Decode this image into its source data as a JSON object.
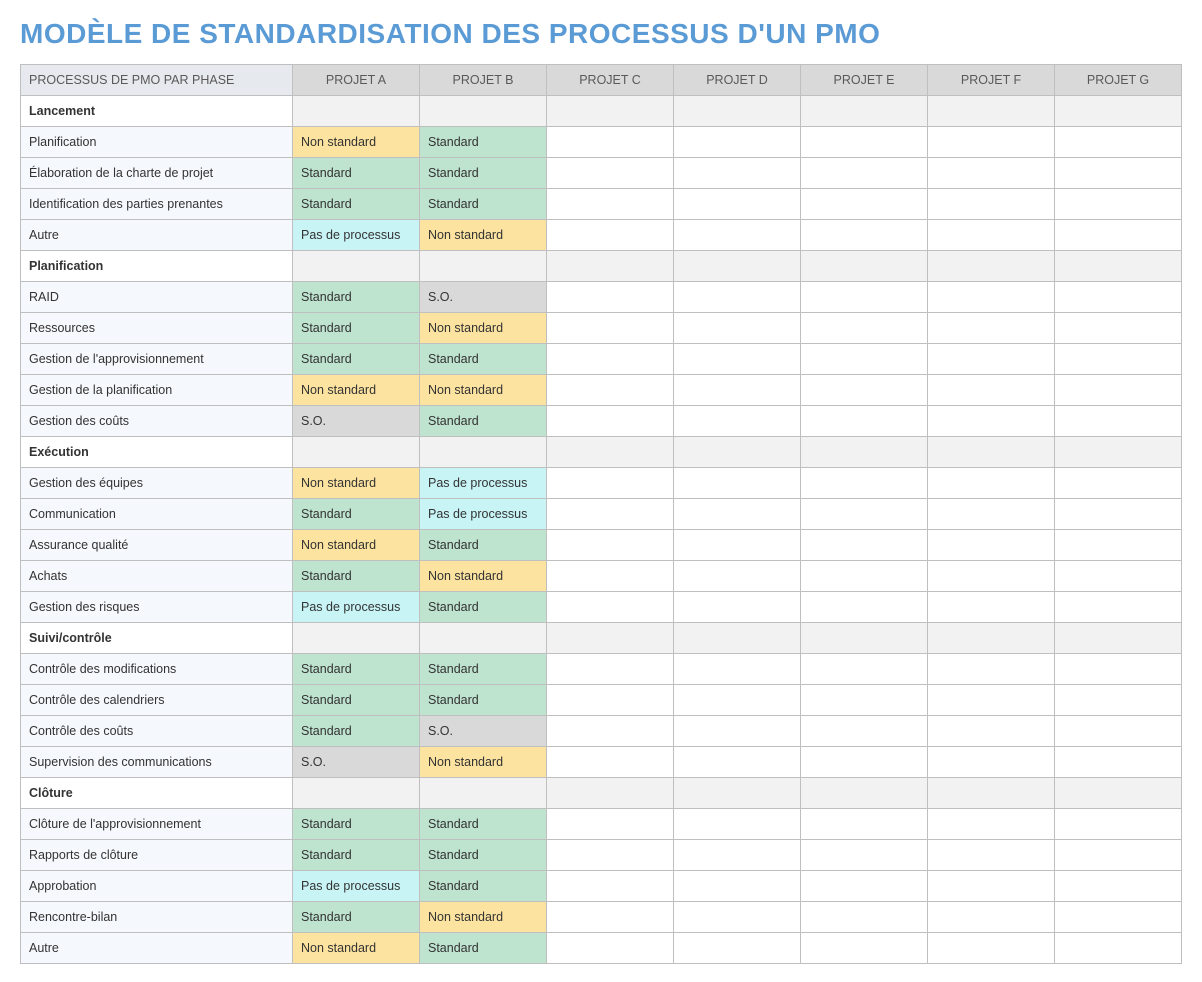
{
  "title": "MODÈLE DE STANDARDISATION DES PROCESSUS D'UN PMO",
  "headers": {
    "rowhead": "PROCESSUS DE PMO PAR PHASE",
    "projects": [
      "PROJET A",
      "PROJET B",
      "PROJET C",
      "PROJET D",
      "PROJET E",
      "PROJET F",
      "PROJET G"
    ]
  },
  "status_labels": {
    "standard": "Standard",
    "nonstd": "Non standard",
    "noproc": "Pas de processus",
    "so": "S.O."
  },
  "phases": [
    {
      "name": "Lancement",
      "rows": [
        {
          "label": "Planification",
          "cells": [
            "nonstd",
            "standard",
            "",
            "",
            "",
            "",
            ""
          ]
        },
        {
          "label": "Élaboration de la charte de projet",
          "cells": [
            "standard",
            "standard",
            "",
            "",
            "",
            "",
            ""
          ]
        },
        {
          "label": "Identification des parties prenantes",
          "cells": [
            "standard",
            "standard",
            "",
            "",
            "",
            "",
            ""
          ]
        },
        {
          "label": "Autre",
          "cells": [
            "noproc",
            "nonstd",
            "",
            "",
            "",
            "",
            ""
          ]
        }
      ]
    },
    {
      "name": "Planification",
      "rows": [
        {
          "label": "RAID",
          "cells": [
            "standard",
            "so",
            "",
            "",
            "",
            "",
            ""
          ]
        },
        {
          "label": "Ressources",
          "cells": [
            "standard",
            "nonstd",
            "",
            "",
            "",
            "",
            ""
          ]
        },
        {
          "label": "Gestion de l'approvisionnement",
          "cells": [
            "standard",
            "standard",
            "",
            "",
            "",
            "",
            ""
          ]
        },
        {
          "label": "Gestion de la planification",
          "cells": [
            "nonstd",
            "nonstd",
            "",
            "",
            "",
            "",
            ""
          ]
        },
        {
          "label": "Gestion des coûts",
          "cells": [
            "so",
            "standard",
            "",
            "",
            "",
            "",
            ""
          ]
        }
      ]
    },
    {
      "name": "Exécution",
      "rows": [
        {
          "label": "Gestion des équipes",
          "cells": [
            "nonstd",
            "noproc",
            "",
            "",
            "",
            "",
            ""
          ]
        },
        {
          "label": "Communication",
          "cells": [
            "standard",
            "noproc",
            "",
            "",
            "",
            "",
            ""
          ]
        },
        {
          "label": "Assurance qualité",
          "cells": [
            "nonstd",
            "standard",
            "",
            "",
            "",
            "",
            ""
          ]
        },
        {
          "label": "Achats",
          "cells": [
            "standard",
            "nonstd",
            "",
            "",
            "",
            "",
            ""
          ]
        },
        {
          "label": "Gestion des risques",
          "cells": [
            "noproc",
            "standard",
            "",
            "",
            "",
            "",
            ""
          ]
        }
      ]
    },
    {
      "name": "Suivi/contrôle",
      "rows": [
        {
          "label": "Contrôle des modifications",
          "cells": [
            "standard",
            "standard",
            "",
            "",
            "",
            "",
            ""
          ]
        },
        {
          "label": "Contrôle des calendriers",
          "cells": [
            "standard",
            "standard",
            "",
            "",
            "",
            "",
            ""
          ]
        },
        {
          "label": "Contrôle des coûts",
          "cells": [
            "standard",
            "so",
            "",
            "",
            "",
            "",
            ""
          ]
        },
        {
          "label": "Supervision des communications",
          "cells": [
            "so",
            "nonstd",
            "",
            "",
            "",
            "",
            ""
          ]
        }
      ]
    },
    {
      "name": "Clôture",
      "rows": [
        {
          "label": "Clôture de l'approvisionnement",
          "cells": [
            "standard",
            "standard",
            "",
            "",
            "",
            "",
            ""
          ]
        },
        {
          "label": "Rapports de clôture",
          "cells": [
            "standard",
            "standard",
            "",
            "",
            "",
            "",
            ""
          ]
        },
        {
          "label": "Approbation",
          "cells": [
            "noproc",
            "standard",
            "",
            "",
            "",
            "",
            ""
          ]
        },
        {
          "label": "Rencontre-bilan",
          "cells": [
            "standard",
            "nonstd",
            "",
            "",
            "",
            "",
            ""
          ]
        },
        {
          "label": "Autre",
          "cells": [
            "nonstd",
            "standard",
            "",
            "",
            "",
            "",
            ""
          ]
        }
      ]
    }
  ]
}
